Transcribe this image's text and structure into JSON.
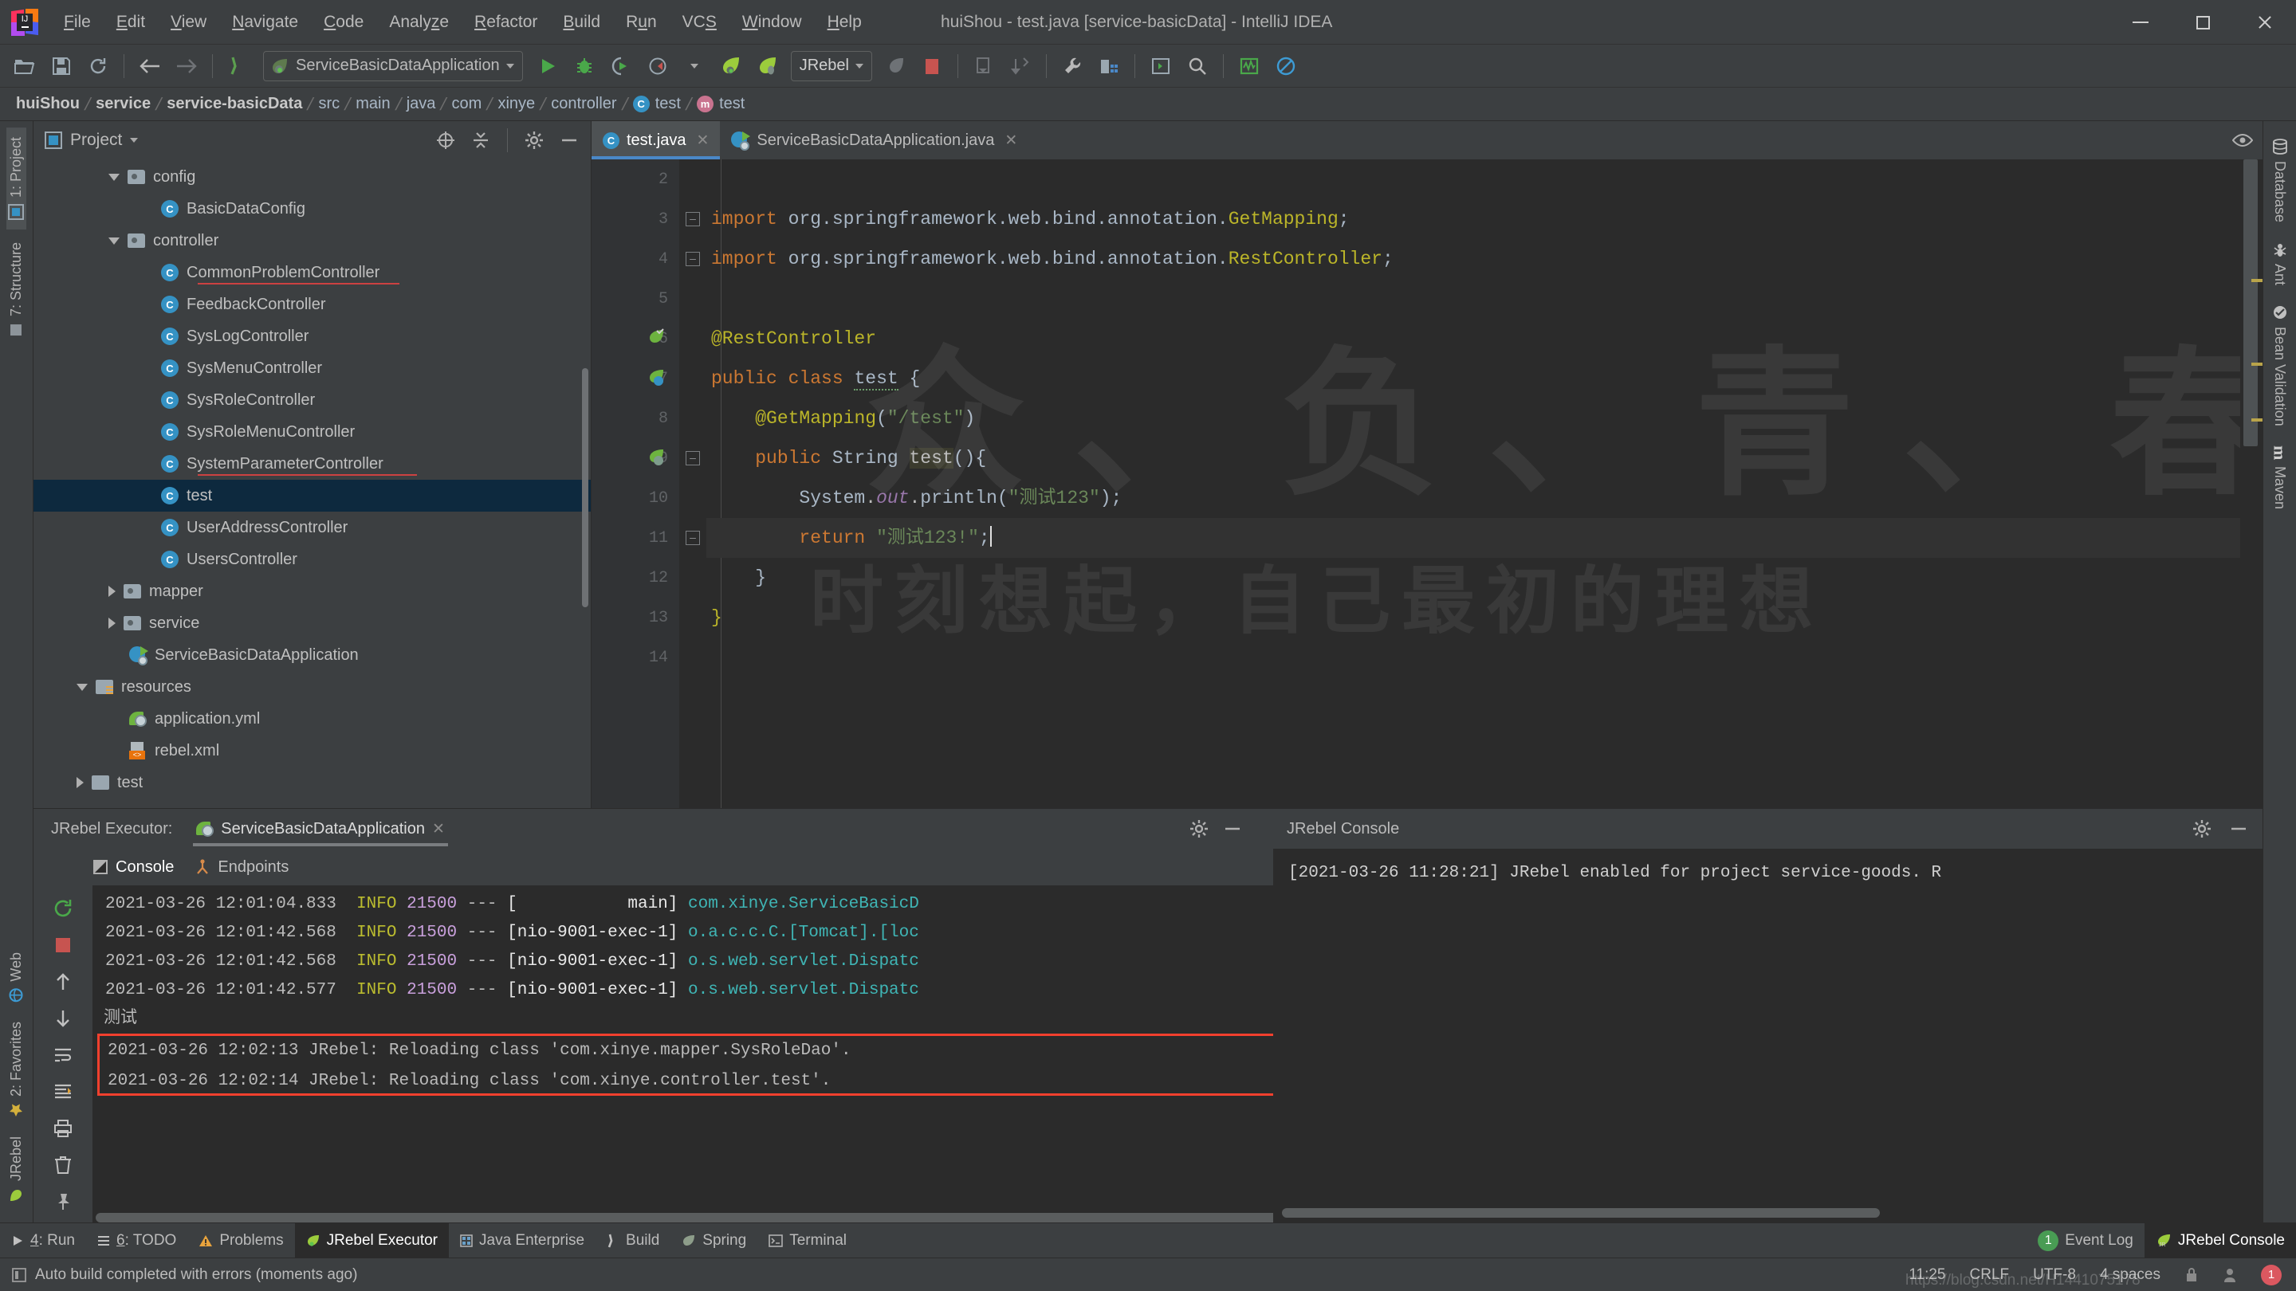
{
  "window": {
    "title": "huiShou - test.java [service-basicData] - IntelliJ IDEA",
    "minimize": "–",
    "maximize": "□",
    "close": "✕"
  },
  "menu": [
    {
      "label": "File",
      "mnemonic": "F"
    },
    {
      "label": "Edit",
      "mnemonic": "E"
    },
    {
      "label": "View",
      "mnemonic": "V"
    },
    {
      "label": "Navigate",
      "mnemonic": "N"
    },
    {
      "label": "Code",
      "mnemonic": "C"
    },
    {
      "label": "Analyze",
      "mnemonic": "z"
    },
    {
      "label": "Refactor",
      "mnemonic": "R"
    },
    {
      "label": "Build",
      "mnemonic": "B"
    },
    {
      "label": "Run",
      "mnemonic": "u"
    },
    {
      "label": "VCS",
      "mnemonic": "S"
    },
    {
      "label": "Window",
      "mnemonic": "W"
    },
    {
      "label": "Help",
      "mnemonic": "H"
    }
  ],
  "toolbar": {
    "run_config": "ServiceBasicDataApplication",
    "jrebel_label": "JRebel",
    "icons": [
      "open-folder-icon",
      "save-icon",
      "sync-icon",
      "back-arrow-icon",
      "forward-arrow-icon",
      "build-icon",
      "run-icon",
      "debug-icon",
      "run-with-coverage-icon",
      "profile-icon",
      "jrebel-run-icon",
      "jrebel-debug-icon",
      "hotswap-icon",
      "stop-icon",
      "update-app-icon",
      "vcs-update-icon",
      "settings-wrench-icon",
      "project-structure-icon",
      "open-terminal-icon",
      "search-everywhere-icon",
      "monitor-icon",
      "disable-icon"
    ]
  },
  "breadcrumb": [
    {
      "label": "huiShou",
      "icon": "",
      "bold": true
    },
    {
      "label": "service",
      "icon": "",
      "bold": true
    },
    {
      "label": "service-basicData",
      "icon": "",
      "bold": true
    },
    {
      "label": "src",
      "icon": "",
      "bold": false
    },
    {
      "label": "main",
      "icon": "",
      "bold": false
    },
    {
      "label": "java",
      "icon": "",
      "bold": false
    },
    {
      "label": "com",
      "icon": "",
      "bold": false
    },
    {
      "label": "xinye",
      "icon": "",
      "bold": false
    },
    {
      "label": "controller",
      "icon": "",
      "bold": false
    },
    {
      "label": "test",
      "icon": "c",
      "bold": false
    },
    {
      "label": "test",
      "icon": "m",
      "bold": false
    }
  ],
  "left_sidebar": [
    {
      "label": "1: Project",
      "icon": "project-icon",
      "active": true
    },
    {
      "label": "7: Structure",
      "icon": "structure-icon",
      "active": false
    },
    {
      "label": "Web",
      "icon": "web-icon",
      "active": false
    },
    {
      "label": "2: Favorites",
      "icon": "favorites-icon",
      "active": false
    },
    {
      "label": "JRebel",
      "icon": "jrebel-icon",
      "active": false
    }
  ],
  "right_sidebar": [
    {
      "label": "Database",
      "icon": "database-icon"
    },
    {
      "label": "Ant",
      "icon": "ant-icon"
    },
    {
      "label": "Bean Validation",
      "icon": "bean-validation-icon"
    },
    {
      "label": "Maven",
      "icon": "maven-icon"
    }
  ],
  "project_panel": {
    "title": "Project",
    "header_icons": [
      "locate-icon",
      "collapse-all-icon",
      "settings-gear-icon",
      "hide-icon"
    ],
    "tree": [
      {
        "label": "config",
        "type": "folder",
        "arrow": "down",
        "indent": 2
      },
      {
        "label": "BasicDataConfig",
        "type": "class",
        "arrow": "none",
        "indent": 3
      },
      {
        "label": "controller",
        "type": "folder",
        "arrow": "down",
        "indent": 2
      },
      {
        "label": "CommonProblemController",
        "type": "class",
        "arrow": "none",
        "indent": 3,
        "error": true
      },
      {
        "label": "FeedbackController",
        "type": "class",
        "arrow": "none",
        "indent": 3
      },
      {
        "label": "SysLogController",
        "type": "class",
        "arrow": "none",
        "indent": 3
      },
      {
        "label": "SysMenuController",
        "type": "class",
        "arrow": "none",
        "indent": 3
      },
      {
        "label": "SysRoleController",
        "type": "class",
        "arrow": "none",
        "indent": 3
      },
      {
        "label": "SysRoleMenuController",
        "type": "class",
        "arrow": "none",
        "indent": 3
      },
      {
        "label": "SystemParameterController",
        "type": "class",
        "arrow": "none",
        "indent": 3,
        "error": true
      },
      {
        "label": "test",
        "type": "class",
        "arrow": "none",
        "indent": 3,
        "selected": true
      },
      {
        "label": "UserAddressController",
        "type": "class",
        "arrow": "none",
        "indent": 3
      },
      {
        "label": "UsersController",
        "type": "class",
        "arrow": "none",
        "indent": 3
      },
      {
        "label": "mapper",
        "type": "folder",
        "arrow": "right",
        "indent": 2
      },
      {
        "label": "service",
        "type": "folder",
        "arrow": "right",
        "indent": 2
      },
      {
        "label": "ServiceBasicDataApplication",
        "type": "springboot",
        "arrow": "none",
        "indent": 2
      },
      {
        "label": "resources",
        "type": "resources",
        "arrow": "down",
        "indent": 1
      },
      {
        "label": "application.yml",
        "type": "spring",
        "arrow": "none",
        "indent": 2
      },
      {
        "label": "rebel.xml",
        "type": "xml",
        "arrow": "none",
        "indent": 2
      },
      {
        "label": "test",
        "type": "plainfolder",
        "arrow": "right",
        "indent": 1
      }
    ]
  },
  "editor": {
    "tabs": [
      {
        "label": "test.java",
        "icon": "class-icon",
        "active": true,
        "closable": true
      },
      {
        "label": "ServiceBasicDataApplication.java",
        "icon": "springboot-icon",
        "active": false,
        "closable": true
      }
    ],
    "lines": [
      {
        "num": "2",
        "text": "",
        "gutter": ""
      },
      {
        "num": "3",
        "text": "import org.springframework.web.bind.annotation.GetMapping;",
        "gutter": "",
        "fold": "start"
      },
      {
        "num": "4",
        "text": "import org.springframework.web.bind.annotation.RestController;",
        "gutter": "",
        "fold": "end"
      },
      {
        "num": "5",
        "text": "",
        "gutter": ""
      },
      {
        "num": "6",
        "text": "@RestController",
        "gutter": "spring-bean-icon"
      },
      {
        "num": "7",
        "text": "public class test {",
        "gutter": "spring-class-icon"
      },
      {
        "num": "8",
        "text": "    @GetMapping(\"/test\")",
        "gutter": ""
      },
      {
        "num": "9",
        "text": "    public String test(){",
        "gutter": "spring-mapping-icon",
        "fold": "start"
      },
      {
        "num": "10",
        "text": "        System.out.println(\"测试123\");",
        "gutter": ""
      },
      {
        "num": "11",
        "text": "        return \"测试123!\";",
        "gutter": "",
        "cursor": true
      },
      {
        "num": "12",
        "text": "    }",
        "gutter": "",
        "fold": "end"
      },
      {
        "num": "13",
        "text": "}",
        "gutter": ""
      },
      {
        "num": "14",
        "text": "",
        "gutter": ""
      }
    ]
  },
  "watermark": {
    "line1": "众、负、青、春",
    "line2": "时刻想起，自己最初的理想"
  },
  "run_panel": {
    "executor_label": "JRebel Executor:",
    "tab": "ServiceBasicDataApplication",
    "subtabs": [
      {
        "label": "Console",
        "icon": "console-icon",
        "active": true
      },
      {
        "label": "Endpoints",
        "icon": "endpoints-icon",
        "active": false
      }
    ],
    "side_icons": [
      "rerun-icon",
      "stop-icon",
      "up-icon",
      "down-icon",
      "soft-wrap-icon",
      "scroll-end-icon",
      "print-icon",
      "clear-icon",
      "pin-icon"
    ],
    "logs": [
      {
        "ts": "2021-03-26 12:01:04.833",
        "level": "INFO",
        "pid": "21500",
        "dash": "---",
        "thread": "[           main]",
        "cls": "com.xinye.ServiceBasicD"
      },
      {
        "ts": "2021-03-26 12:01:42.568",
        "level": "INFO",
        "pid": "21500",
        "dash": "---",
        "thread": "[nio-9001-exec-1]",
        "cls": "o.a.c.c.C.[Tomcat].[loc"
      },
      {
        "ts": "2021-03-26 12:01:42.568",
        "level": "INFO",
        "pid": "21500",
        "dash": "---",
        "thread": "[nio-9001-exec-1]",
        "cls": "o.s.web.servlet.Dispatc"
      },
      {
        "ts": "2021-03-26 12:01:42.577",
        "level": "INFO",
        "pid": "21500",
        "dash": "---",
        "thread": "[nio-9001-exec-1]",
        "cls": "o.s.web.servlet.Dispatc"
      }
    ],
    "stdout": "测试",
    "highlighted": [
      "2021-03-26 12:02:13 JRebel: Reloading class 'com.xinye.mapper.SysRoleDao'.",
      "2021-03-26 12:02:14 JRebel: Reloading class 'com.xinye.controller.test'."
    ],
    "highlight_color": "#f2402e"
  },
  "jrebel_console": {
    "title": "JRebel Console",
    "header_icons": [
      "settings-gear-icon",
      "hide-icon"
    ],
    "line": "[2021-03-26 11:28:21] JRebel enabled for project service-goods. R"
  },
  "toolwindow_bar": [
    {
      "label": "4: Run",
      "icon": "run-icon",
      "active": false,
      "mnemonic": "4"
    },
    {
      "label": "6: TODO",
      "icon": "todo-icon",
      "active": false,
      "mnemonic": "6"
    },
    {
      "label": "Problems",
      "icon": "warning-icon",
      "active": false
    },
    {
      "label": "JRebel Executor",
      "icon": "jrebel-icon",
      "active": true
    },
    {
      "label": "Java Enterprise",
      "icon": "java-enterprise-icon",
      "active": false
    },
    {
      "label": "Build",
      "icon": "build-icon",
      "active": false
    },
    {
      "label": "Spring",
      "icon": "spring-icon",
      "active": false
    },
    {
      "label": "Terminal",
      "icon": "terminal-icon",
      "active": false
    }
  ],
  "toolwindow_right": [
    {
      "label": "Event Log",
      "icon": "event-log-icon",
      "badge": "1",
      "active": false
    },
    {
      "label": "JRebel Console",
      "icon": "jrebel-rocket-icon",
      "active": true
    }
  ],
  "status_bar": {
    "message": "Auto build completed with errors (moments ago)",
    "caret": "11:25",
    "line_sep": "CRLF",
    "encoding": "UTF-8",
    "indent": "4 spaces",
    "watermark": "https://blog.csdn.net/H1441075178",
    "error_badge": "1"
  }
}
